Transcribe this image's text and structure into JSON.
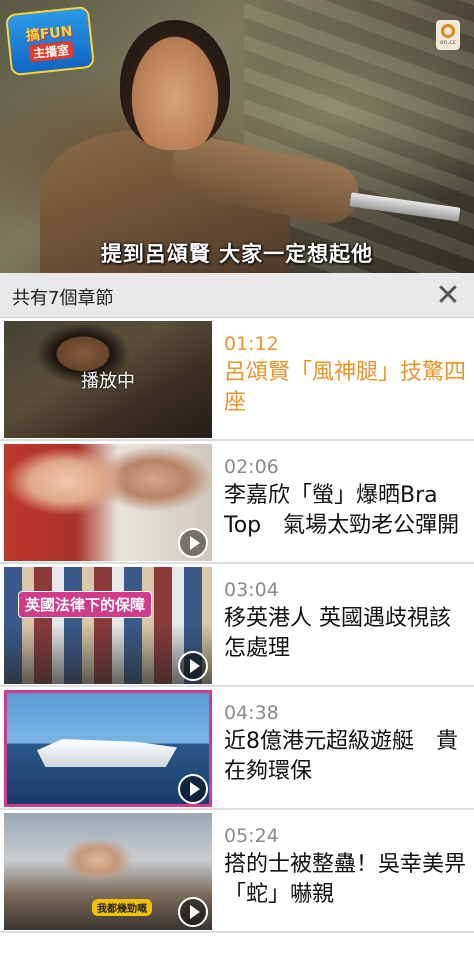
{
  "player": {
    "subtitle": "提到呂頌賢 大家一定想起他",
    "channel_logo_line1": "搞FUN",
    "channel_logo_line2": "主播室",
    "corner_badge_text": "on.cc"
  },
  "chapters_header": {
    "count_label": "共有7個章節",
    "close_label": "✕"
  },
  "chapters": [
    {
      "time": "01:12",
      "title": "呂頌賢「風神腿」技驚四座",
      "thumb_overlay": "播放中",
      "active": true
    },
    {
      "time": "02:06",
      "title": "李嘉欣「螢」爆晒Bra Top　氣場太勁老公彈開",
      "active": false
    },
    {
      "time": "03:04",
      "title": "移英港人 英國遇歧視該怎處理",
      "thumb_tag": "英國法律下的保障",
      "active": false
    },
    {
      "time": "04:38",
      "title": "近8億港元超級遊艇　貴在夠環保",
      "active": false
    },
    {
      "time": "05:24",
      "title": "搭的士被整蠱！吳幸美畀「蛇」嚇親",
      "thumb_tag": "我都幾勁嘅",
      "active": false
    }
  ]
}
